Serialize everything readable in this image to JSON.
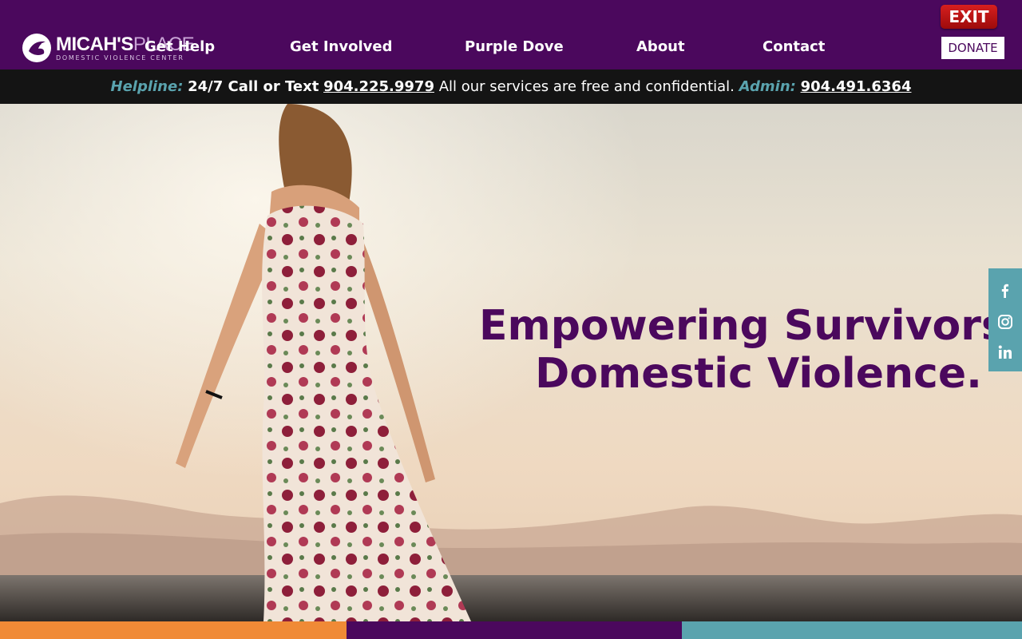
{
  "header": {
    "logo": {
      "name_bold": "MICAH'S",
      "name_light": "PLACE",
      "subtitle": "DOMESTIC VIOLENCE CENTER",
      "icon": "dove-icon"
    },
    "nav": [
      {
        "label": "Get Help"
      },
      {
        "label": "Get Involved"
      },
      {
        "label": "Purple Dove"
      },
      {
        "label": "About"
      },
      {
        "label": "Contact"
      }
    ],
    "exit_label": "EXIT",
    "donate_label": "DONATE"
  },
  "helpline": {
    "helpline_label": "Helpline:",
    "call_text": "24/7 Call or Text",
    "helpline_phone": "904.225.9979",
    "free_text": "All our services are free and confidential.",
    "admin_label": "Admin:",
    "admin_phone": "904.491.6364"
  },
  "hero": {
    "title_line1": "Empowering Survivors of",
    "title_line2": "Domestic Violence."
  },
  "social": [
    {
      "icon": "facebook-icon"
    },
    {
      "icon": "instagram-icon"
    },
    {
      "icon": "linkedin-icon"
    }
  ],
  "colors": {
    "brand_purple": "#4b085d",
    "accent_teal": "#5aa3ae",
    "accent_orange": "#f08a36",
    "exit_red": "#c01616",
    "helpbar_bg": "#141414"
  }
}
